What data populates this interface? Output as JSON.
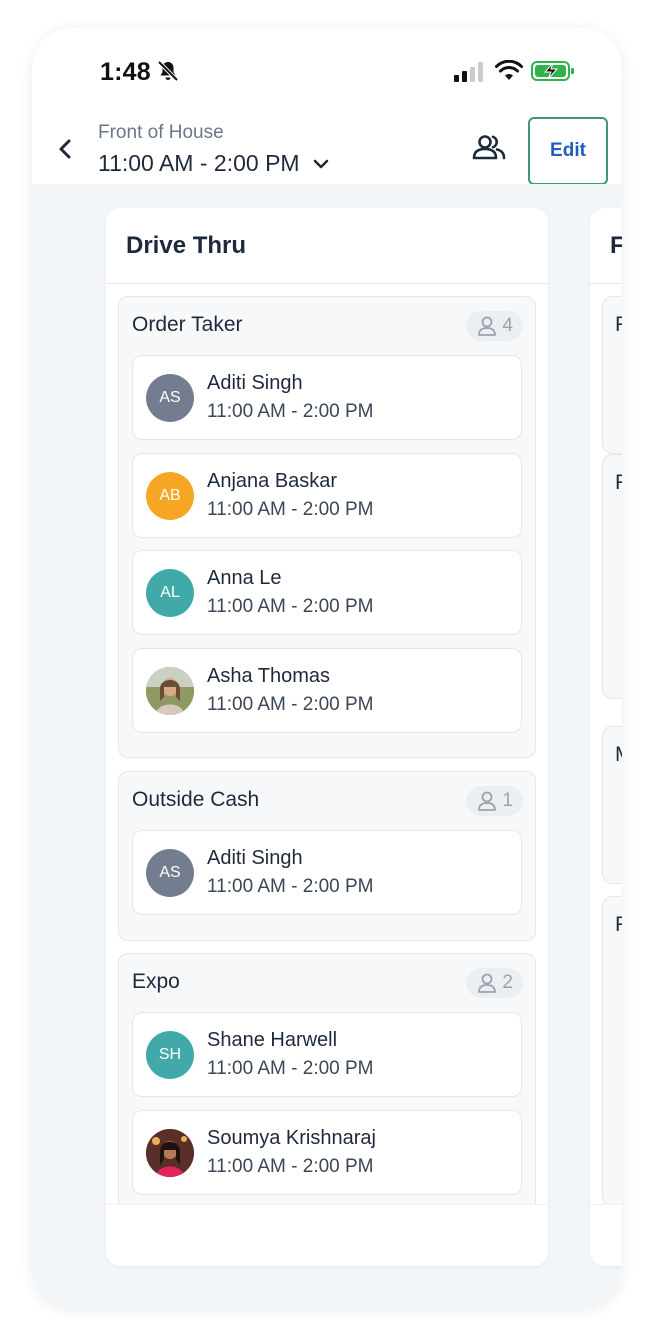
{
  "status_bar": {
    "time": "1:48"
  },
  "header": {
    "subtitle": "Front of House",
    "shift": "11:00 AM - 2:00 PM",
    "edit_label": "Edit"
  },
  "columns": [
    {
      "title": "Drive Thru",
      "groups": [
        {
          "title": "Order Taker",
          "count": "4",
          "employees": [
            {
              "initials": "AS",
              "name": "Aditi Singh",
              "time": "11:00 AM - 2:00 PM",
              "color": "#737d8f"
            },
            {
              "initials": "AB",
              "name": "Anjana Baskar",
              "time": "11:00 AM - 2:00 PM",
              "color": "#f6a623"
            },
            {
              "initials": "AL",
              "name": "Anna Le",
              "time": "11:00 AM - 2:00 PM",
              "color": "#41aaa8"
            },
            {
              "initials": "",
              "name": "Asha Thomas",
              "time": "11:00 AM - 2:00 PM",
              "color": "#9c8a76"
            }
          ]
        },
        {
          "title": "Outside Cash",
          "count": "1",
          "employees": [
            {
              "initials": "AS",
              "name": "Aditi Singh",
              "time": "11:00 AM - 2:00 PM",
              "color": "#737d8f"
            }
          ]
        },
        {
          "title": "Expo",
          "count": "2",
          "employees": [
            {
              "initials": "SH",
              "name": "Shane Harwell",
              "time": "11:00 AM - 2:00 PM",
              "color": "#41aaa8"
            },
            {
              "initials": "",
              "name": "Soumya Krishnaraj",
              "time": "11:00 AM - 2:00 PM",
              "color": "#7a4a3c"
            }
          ]
        }
      ]
    },
    {
      "title": "F",
      "groups": [
        {
          "title": "F"
        },
        {
          "title": "F"
        },
        {
          "title": "M"
        },
        {
          "title": "F"
        }
      ]
    }
  ]
}
